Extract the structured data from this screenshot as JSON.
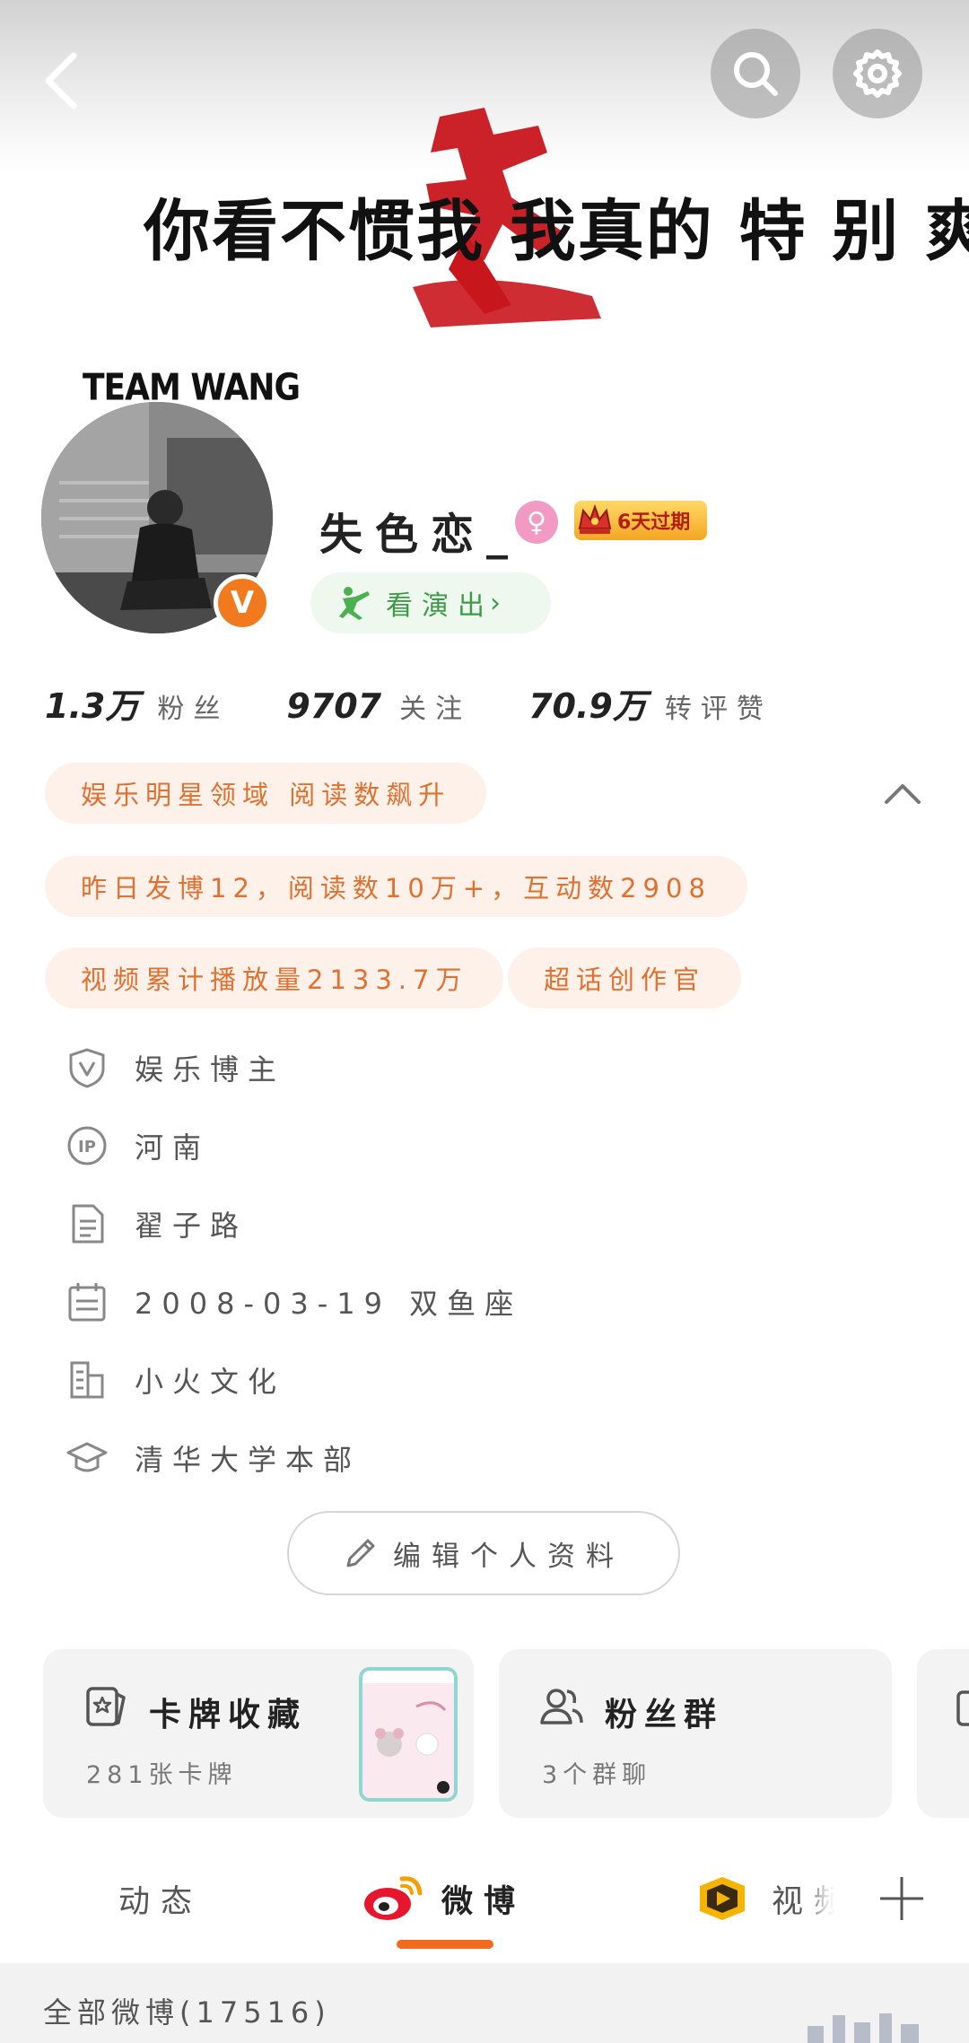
{
  "header": {
    "cover_text": "你看不惯我 我真的 特 别 爽"
  },
  "profile": {
    "team_label": "TEAM WANG",
    "verified_badge": "V",
    "username": "失色恋_",
    "gender": "female",
    "vip_label": "6天过期",
    "show_button": "看演出",
    "show_chevron": "›"
  },
  "stats": [
    {
      "value": "1.3万",
      "label": "粉丝"
    },
    {
      "value": "9707",
      "label": "关注"
    },
    {
      "value": "70.9万",
      "label": "转评赞"
    }
  ],
  "tags": {
    "domain": "娱乐明星领域 阅读数飙升",
    "yesterday": "昨日发博12，阅读数10万+，互动数2908",
    "video": "视频累计播放量2133.7万",
    "super_topic": "超话创作官"
  },
  "info": {
    "verified": "娱乐博主",
    "ip": "河南",
    "bio": "翟子路",
    "birthday": "2008-03-19 双鱼座",
    "company": "小火文化",
    "school": "清华大学本部"
  },
  "edit_button": "编辑个人资料",
  "cards": {
    "collection_title": "卡牌收藏",
    "collection_sub": "281张卡牌",
    "fan_group_title": "粉丝群",
    "fan_group_sub": "3个群聊"
  },
  "tabs": {
    "feed": "动态",
    "weibo": "微博",
    "video": "视频",
    "plus": "+"
  },
  "filter": {
    "label": "全部微博(17516)"
  },
  "colors": {
    "accent": "#f26a1b",
    "tag_text": "#e0702f",
    "tag_bg": "#fdf1ea",
    "show_green": "#3d9a47",
    "brush_red": "#c8161d"
  },
  "icons": {
    "back": "chevron-left-icon",
    "search": "search-icon",
    "settings": "gear-icon",
    "collapse": "chevron-up-icon",
    "verified": "shield-v-icon",
    "ip": "ip-icon",
    "bio": "document-icon",
    "birthday": "calendar-icon",
    "company": "building-icon",
    "school": "graduation-cap-icon",
    "edit": "pencil-icon",
    "collection": "card-icon",
    "fan_group": "group-icon",
    "weibo": "weibo-logo-icon",
    "video": "video-badge-icon",
    "plus": "plus-icon",
    "filter": "bars-icon"
  }
}
